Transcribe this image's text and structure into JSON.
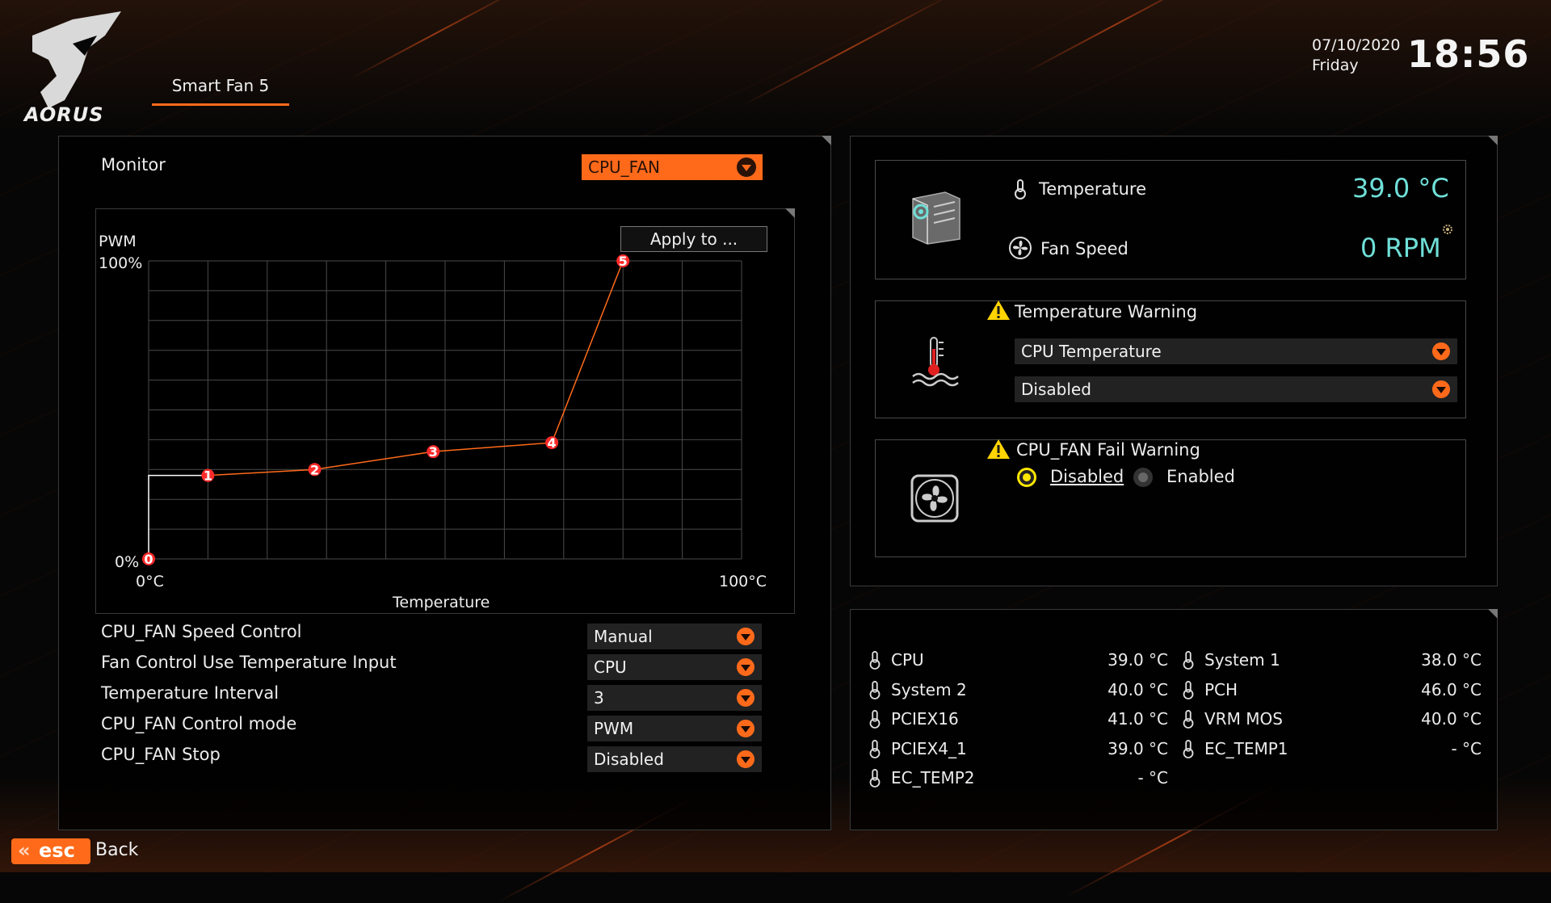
{
  "header": {
    "logo_text": "AORUS",
    "tab_label": "Smart Fan 5",
    "date": "07/10/2020",
    "day": "Friday",
    "time": "18:56"
  },
  "monitor": {
    "label": "Monitor",
    "selected": "CPU_FAN"
  },
  "chart_data": {
    "type": "line",
    "title": "",
    "xlabel": "Temperature",
    "ylabel": "PWM",
    "x_tick_min_label": "0°C",
    "x_tick_max_label": "100°C",
    "y_tick_min_label": "0%",
    "y_tick_max_label": "100%",
    "xlim": [
      0,
      100
    ],
    "ylim": [
      0,
      100
    ],
    "grid": true,
    "series": [
      {
        "points": [
          {
            "label": "0",
            "x": 0,
            "y": 0
          },
          {
            "label": "1",
            "x": 10,
            "y": 28
          },
          {
            "label": "2",
            "x": 28,
            "y": 30
          },
          {
            "label": "3",
            "x": 48,
            "y": 36
          },
          {
            "label": "4",
            "x": 68,
            "y": 39
          },
          {
            "label": "5",
            "x": 80,
            "y": 100
          }
        ]
      }
    ],
    "line_color": "#ff6a1a",
    "point_color": "#ff2a2a"
  },
  "apply_button": "Apply to ...",
  "settings": [
    {
      "label": "CPU_FAN Speed Control",
      "value": "Manual"
    },
    {
      "label": "Fan Control Use Temperature Input",
      "value": "CPU"
    },
    {
      "label": "Temperature Interval",
      "value": "3"
    },
    {
      "label": "CPU_FAN Control mode",
      "value": "PWM"
    },
    {
      "label": "CPU_FAN Stop",
      "value": "Disabled"
    }
  ],
  "status": {
    "temperature_label": "Temperature",
    "temperature_value": "39.0 °C",
    "fan_speed_label": "Fan Speed",
    "fan_speed_value": "0 RPM"
  },
  "temp_warning": {
    "title": "Temperature Warning",
    "source": "CPU Temperature",
    "value": "Disabled"
  },
  "fan_fail_warning": {
    "title": "CPU_FAN Fail Warning",
    "options": [
      "Disabled",
      "Enabled"
    ],
    "selected": "Disabled"
  },
  "temps": [
    {
      "name": "CPU",
      "value": "39.0 °C"
    },
    {
      "name": "System 1",
      "value": "38.0 °C"
    },
    {
      "name": "System 2",
      "value": "40.0 °C"
    },
    {
      "name": "PCH",
      "value": "46.0 °C"
    },
    {
      "name": "PCIEX16",
      "value": "41.0 °C"
    },
    {
      "name": "VRM MOS",
      "value": "40.0 °C"
    },
    {
      "name": "PCIEX4_1",
      "value": "39.0 °C"
    },
    {
      "name": "EC_TEMP1",
      "value": "- °C"
    },
    {
      "name": "EC_TEMP2",
      "value": "- °C"
    }
  ],
  "footer": {
    "esc_label": "esc",
    "back_label": "Back"
  },
  "colors": {
    "accent": "#ff6a1a",
    "value_cyan": "#6fe0d8",
    "radio_selected": "#ffe600"
  }
}
